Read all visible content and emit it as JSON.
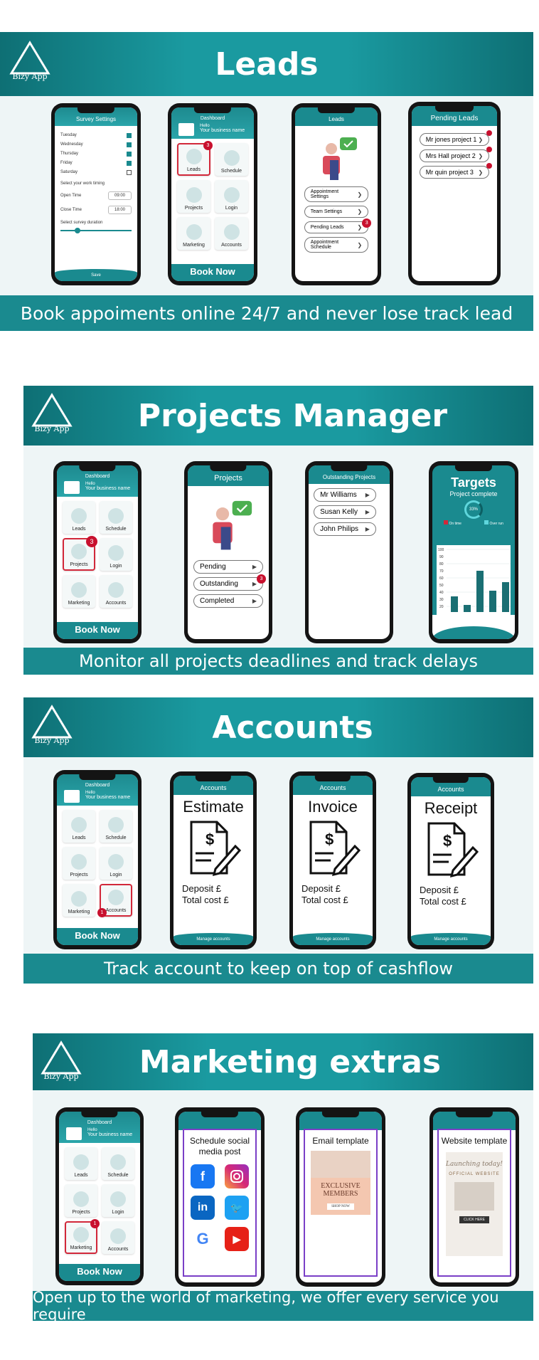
{
  "brand": {
    "logo_text": "Bizy App",
    "accent": "#1a8a8f",
    "badge": "#c8102e"
  },
  "sections": {
    "leads": {
      "title": "Leads",
      "footer": "Book appoiments online 24/7 and never lose track lead",
      "survey": {
        "title": "Survey Settings",
        "days": [
          "Tuesday",
          "Wednesday",
          "Thursday",
          "Friday",
          "Saturday"
        ],
        "work_timing": "Select your work timing",
        "open_label": "Open Time",
        "open_value": "09:00",
        "close_label": "Close Time",
        "close_value": "18:00",
        "duration": "Select survey duration",
        "save": "Save"
      },
      "dashboard": {
        "title": "Dashboard",
        "hello": "Hello",
        "business": "Your business name",
        "tiles": [
          "Leads",
          "Schedule",
          "Projects",
          "Login",
          "Marketing",
          "Accounts"
        ],
        "badge": "3",
        "book_now": "Book Now"
      },
      "leads_menu": {
        "title": "Leads",
        "items": [
          "Appointment Settings",
          "Team Settings",
          "Pending Leads",
          "Appointment Schedule"
        ],
        "badge": "3"
      },
      "pending": {
        "title": "Pending Leads",
        "items": [
          "Mr jones project 1",
          "Mrs Hall project 2",
          "Mr quin project 3"
        ]
      }
    },
    "projects": {
      "title": "Projects Manager",
      "footer": "Monitor all projects deadlines and track delays",
      "dashboard": {
        "title": "Dashboard",
        "hello": "Hello",
        "business": "Your business name",
        "tiles": [
          "Leads",
          "Schedule",
          "Projects",
          "Login",
          "Marketing",
          "Accounts"
        ],
        "badge": "3",
        "book_now": "Book Now"
      },
      "projects_menu": {
        "title": "Projects",
        "items": [
          "Pending",
          "Outstanding",
          "Completed"
        ],
        "badge": "3"
      },
      "outstanding": {
        "title": "Outstanding Projects",
        "items": [
          "Mr Williams",
          "Susan Kelly",
          "John Philips"
        ]
      },
      "targets": {
        "title": "Targets",
        "subtitle": "Project complete",
        "percent": "33%",
        "legend": [
          "On time",
          "Over run"
        ]
      }
    },
    "accounts": {
      "title": "Accounts",
      "footer": "Track account to keep on top of cashflow",
      "dashboard": {
        "title": "Dashboard",
        "hello": "Hello",
        "business": "Your business name",
        "tiles": [
          "Leads",
          "Schedule",
          "Projects",
          "Login",
          "Marketing",
          "Accounts"
        ],
        "badge": "1",
        "book_now": "Book Now"
      },
      "docs": [
        {
          "appbar": "Accounts",
          "title": "Estimate",
          "deposit": "Deposit £",
          "total": "Total cost £",
          "manage": "Manage accounts"
        },
        {
          "appbar": "Accounts",
          "title": "Invoice",
          "deposit": "Deposit £",
          "total": "Total cost £",
          "manage": "Manage accounts"
        },
        {
          "appbar": "Accounts",
          "title": "Receipt",
          "deposit": "Deposit £",
          "total": "Total cost £",
          "manage": "Manage accounts"
        }
      ]
    },
    "marketing": {
      "title": "Marketing extras",
      "footer": "Open up to the world of marketing, we offer every service you require",
      "dashboard": {
        "title": "Dashboard",
        "hello": "Hello",
        "business": "Your business name",
        "tiles": [
          "Leads",
          "Schedule",
          "Projects",
          "Login",
          "Marketing",
          "Accounts"
        ],
        "badge": "1",
        "book_now": "Book Now"
      },
      "social": {
        "title": "Schedule social media post",
        "icons": [
          "facebook-icon",
          "instagram-icon",
          "linkedin-icon",
          "twitter-icon",
          "google-icon",
          "youtube-icon"
        ]
      },
      "email": {
        "title": "Email template",
        "line1": "EXCLUSIVE",
        "line2": "MEMBERS",
        "button": "SHOP NOW"
      },
      "website": {
        "title": "Website template",
        "script": "Launching today!",
        "line": "OFFICIAL WEBSITE",
        "button": "CLICK HERE"
      }
    }
  }
}
